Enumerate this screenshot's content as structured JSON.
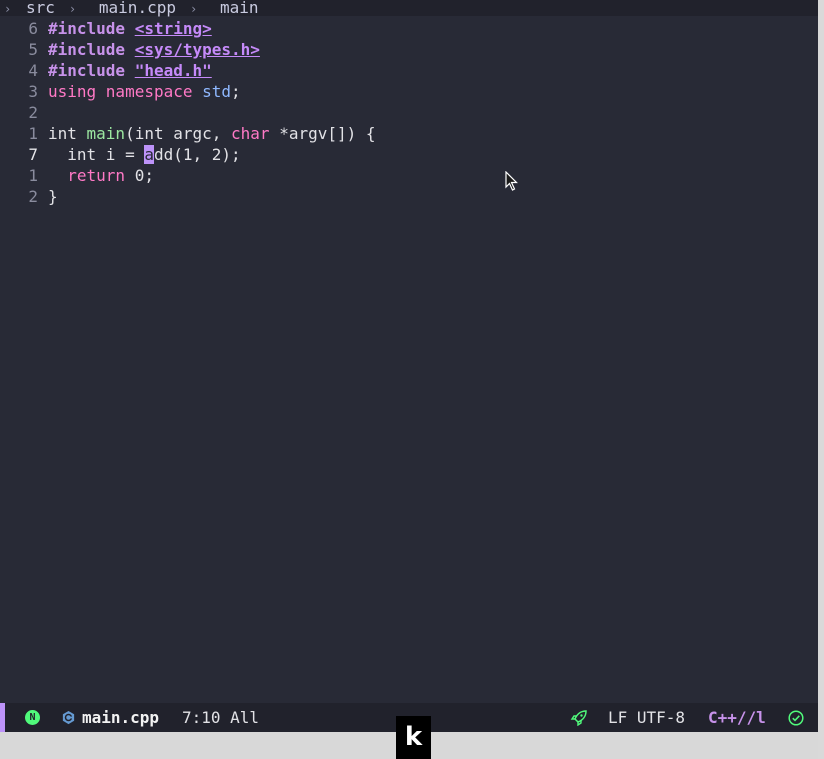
{
  "breadcrumb": {
    "items": [
      "src",
      "main.cpp",
      "main"
    ],
    "separator": "›"
  },
  "editor": {
    "lines": [
      {
        "num": "6",
        "tokens": [
          {
            "t": "#include ",
            "c": "kw"
          },
          {
            "t": "<string>",
            "c": "lib"
          }
        ]
      },
      {
        "num": "5",
        "tokens": [
          {
            "t": "#include ",
            "c": "kw"
          },
          {
            "t": "<sys/types.h>",
            "c": "lib"
          }
        ]
      },
      {
        "num": "4",
        "tokens": [
          {
            "t": "#include ",
            "c": "kw"
          },
          {
            "t": "\"head.h\"",
            "c": "lib"
          }
        ]
      },
      {
        "num": "3",
        "tokens": [
          {
            "t": "using ",
            "c": "kw2"
          },
          {
            "t": "namespace ",
            "c": "kw2"
          },
          {
            "t": "std",
            "c": "ns"
          },
          {
            "t": ";",
            "c": ""
          }
        ]
      },
      {
        "num": "2",
        "tokens": []
      },
      {
        "num": "1",
        "tokens": [
          {
            "t": "int ",
            "c": "type"
          },
          {
            "t": "main",
            "c": "fn"
          },
          {
            "t": "(",
            "c": ""
          },
          {
            "t": "int ",
            "c": "type"
          },
          {
            "t": "argc, ",
            "c": ""
          },
          {
            "t": "char ",
            "c": "kw2"
          },
          {
            "t": "*argv[]) {",
            "c": ""
          }
        ]
      },
      {
        "num": "7",
        "current": true,
        "tokens": [
          {
            "t": "  int ",
            "c": "type"
          },
          {
            "t": "i = ",
            "c": ""
          },
          {
            "t": "a",
            "c": "cursor"
          },
          {
            "t": "dd(1, 2);",
            "c": ""
          }
        ]
      },
      {
        "num": "1",
        "tokens": [
          {
            "t": "  return ",
            "c": "kw2"
          },
          {
            "t": "0;",
            "c": ""
          }
        ]
      },
      {
        "num": "2",
        "tokens": [
          {
            "t": "}",
            "c": ""
          }
        ]
      }
    ]
  },
  "statusbar": {
    "mode_badge": "N",
    "file_icon": "cpp-file-icon",
    "filename": "main.cpp",
    "position": "7:10 All",
    "rocket_icon": "rocket-icon",
    "encoding": "LF UTF-8",
    "language": "C++//l",
    "check_icon": "check-circle-icon"
  },
  "overlay": {
    "logo": "k"
  },
  "colors": {
    "background": "#282a36",
    "accent": "#bd93f9",
    "keyword": "#c792ea",
    "function": "#9be6a0",
    "ok": "#50fa7b"
  }
}
